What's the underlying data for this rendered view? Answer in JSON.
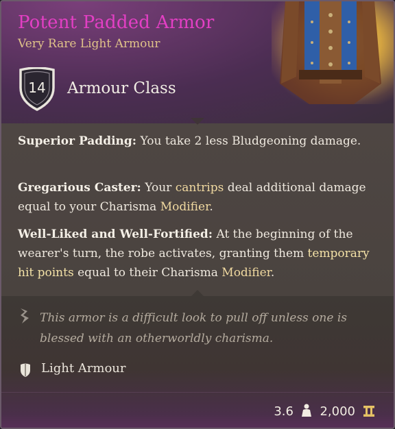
{
  "item": {
    "name": "Potent Padded Armor",
    "rarity_type": "Very Rare Light Armour",
    "armour_class_value": "14",
    "armour_class_label": "Armour Class",
    "colors": {
      "name": "#e33fc4",
      "rarity": "#e0c389",
      "keyword": "#f0d9a0"
    }
  },
  "properties": [
    {
      "title": "Superior Padding:",
      "text": " You take 2 less Bludgeoning damage."
    },
    {
      "title": "Gregarious Caster:",
      "text_a": " Your ",
      "kw_a": "cantrips",
      "text_b": " deal additional damage equal to your Charisma ",
      "kw_b": "Modifier",
      "text_c": "."
    },
    {
      "title": "Well-Liked and Well-Fortified:",
      "text_a": " At the beginning of the wearer's turn, the robe activates, granting them ",
      "kw_a": "temporary hit points",
      "text_b": " equal to their Charisma ",
      "kw_b": "Modifier",
      "text_c": "."
    }
  ],
  "flavor": {
    "icon": "quill-icon",
    "text": "This armor is a difficult look to pull off unless one is blessed with an otherworldly charisma."
  },
  "armor_type": {
    "icon": "shield-icon",
    "label": "Light Armour"
  },
  "footer": {
    "weight": "3.6",
    "weight_icon": "weight-icon",
    "price": "2,000",
    "price_icon": "gold-icon"
  }
}
